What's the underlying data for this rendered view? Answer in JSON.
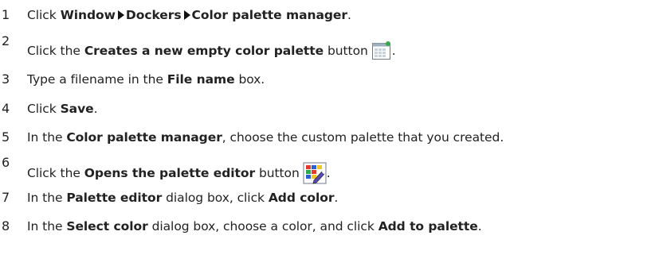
{
  "steps": [
    {
      "number": "1",
      "parts": [
        "Click ",
        "Window",
        "Dockers",
        "Color palette manager",
        "."
      ]
    },
    {
      "number": "2",
      "before": "Click the ",
      "bold": "Creates a new empty color palette",
      "after": " button",
      "icon": "new-palette-icon",
      "end": "."
    },
    {
      "number": "3",
      "before": "Type a filename in the ",
      "bold": "File name",
      "after": " box."
    },
    {
      "number": "4",
      "before": "Click ",
      "bold": "Save",
      "after": "."
    },
    {
      "number": "5",
      "before": "In the ",
      "bold": "Color palette manager",
      "after": ", choose the custom palette that you created."
    },
    {
      "number": "6",
      "before": "Click the ",
      "bold": "Opens the palette editor",
      "after": " button",
      "icon": "palette-editor-icon",
      "end": "."
    },
    {
      "number": "7",
      "before": "In the ",
      "bold": "Palette editor",
      "middle": " dialog box, click ",
      "bold2": "Add color",
      "after": "."
    },
    {
      "number": "8",
      "before": "In the ",
      "bold": "Select color",
      "middle": " dialog box, choose a color, and click ",
      "bold2": "Add to palette",
      "after": "."
    }
  ],
  "colors": {
    "text": "#222222",
    "icon_border": "#6b7a88",
    "icon_green": "#3aa84a",
    "palette_red": "#e23a2e",
    "palette_blue": "#2a5fcf",
    "palette_yellow": "#f2c523",
    "palette_green": "#2fa84a"
  }
}
